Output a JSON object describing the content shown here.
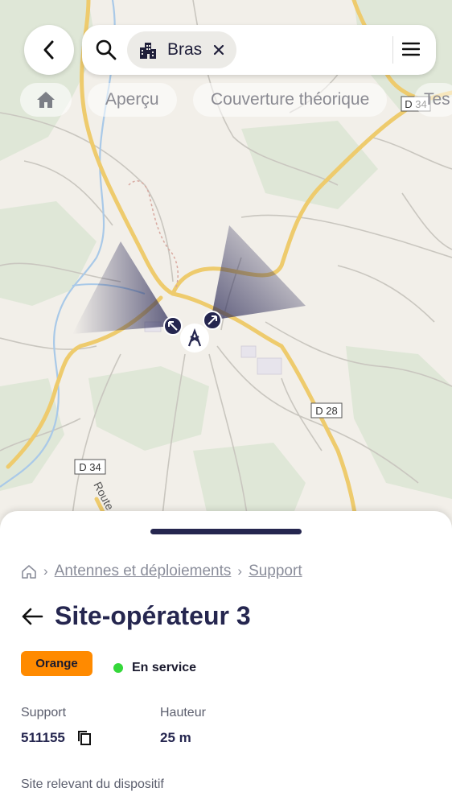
{
  "search": {
    "chip_label": "Bras"
  },
  "tabs": [
    "Aperçu",
    "Couverture théorique",
    "Tes"
  ],
  "map": {
    "road_labels": [
      "D 34",
      "D 28",
      "D 34",
      "Route"
    ]
  },
  "sheet": {
    "breadcrumb": [
      "Antennes et déploiements",
      "Support"
    ],
    "title": "Site-opérateur 3",
    "operator_badge": "Orange",
    "operator_color": "#ff8a00",
    "status": "En service",
    "status_color": "#34d83a",
    "support_label": "Support",
    "support_value": "511155",
    "height_label": "Hauteur",
    "height_value": "25 m",
    "relevant_label": "Site relevant du dispositif"
  },
  "colors": {
    "navy": "#25264f",
    "map_bg": "#f2efe9",
    "road": "#f6d47e"
  }
}
